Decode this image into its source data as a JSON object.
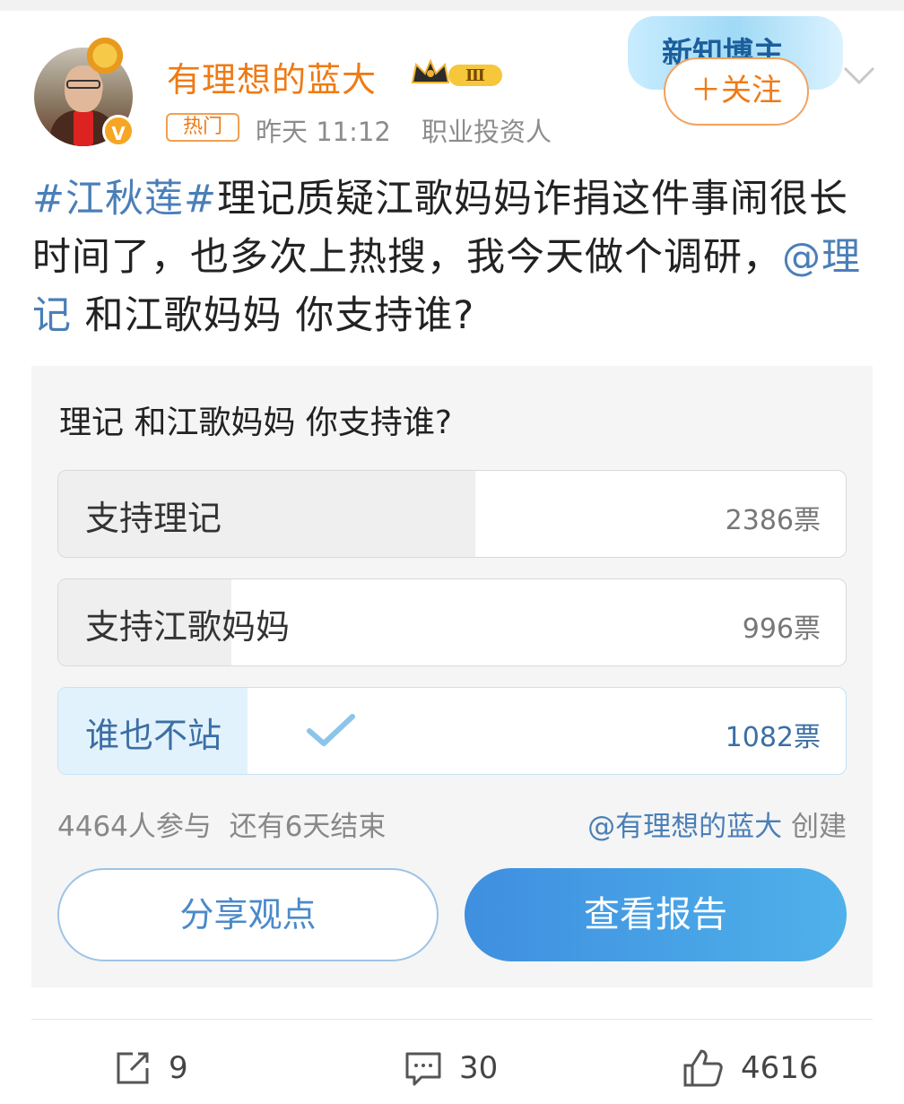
{
  "user": {
    "name": "有理想的蓝大",
    "level_badge": "Ⅲ",
    "hot_tag": "热门",
    "time": "昨天 11:12",
    "profession": "职业投资人",
    "verified_mark": "V"
  },
  "header": {
    "follow_label": "＋关注",
    "banner_text": "新知博主"
  },
  "post": {
    "hashtag": "#江秋莲#",
    "text_1": "理记质疑江歌妈妈诈捐这件事闹很长时间了，也多次上热搜，我今天做个调研，",
    "mention": "@理记",
    "text_2": " 和江歌妈妈 你支持谁?"
  },
  "poll": {
    "title": "理记 和江歌妈妈 你支持谁?",
    "options": [
      {
        "label": "支持理记",
        "votes": 2386,
        "votes_text": "2386票",
        "fraction": 0.53,
        "selected": false
      },
      {
        "label": "支持江歌妈妈",
        "votes": 996,
        "votes_text": "996票",
        "fraction": 0.22,
        "selected": false
      },
      {
        "label": "谁也不站",
        "votes": 1082,
        "votes_text": "1082票",
        "fraction": 0.24,
        "selected": true
      }
    ],
    "participants": "4464人参与",
    "remaining": "还有6天结束",
    "creator_mention": "@有理想的蓝大",
    "creator_suffix": " 创建",
    "share_label": "分享观点",
    "report_label": "查看报告"
  },
  "actions": {
    "repost_count": "9",
    "comment_count": "30",
    "like_count": "4616"
  },
  "colors": {
    "orange": "#f07a14",
    "link_blue": "#4a7fb8",
    "report_gradient_start": "#3f8fe0",
    "report_gradient_end": "#4fb1ea"
  }
}
